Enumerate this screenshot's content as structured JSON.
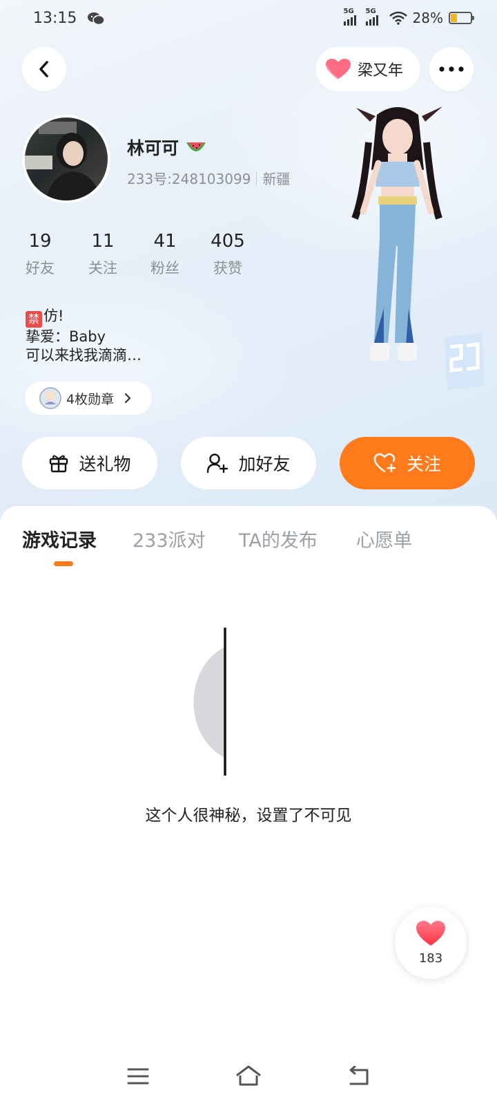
{
  "status_bar": {
    "time": "13:15",
    "network_1": "5G",
    "network_2": "5G",
    "battery": "28%"
  },
  "header": {
    "back_icon": "back-arrow-icon",
    "intimate_name": "梁又年",
    "more_icon": "more-dots-icon"
  },
  "profile": {
    "nickname": "林可可",
    "id_text": "233号:248103099",
    "location": "新疆"
  },
  "stats": [
    {
      "value": "19",
      "label": "好友"
    },
    {
      "value": "11",
      "label": "关注"
    },
    {
      "value": "41",
      "label": "粉丝"
    },
    {
      "value": "405",
      "label": "获赞"
    }
  ],
  "bio": {
    "ban_badge": "禁",
    "line1": "仿!",
    "line2": "挚爱：Baby",
    "line3": "可以来找我滴滴…"
  },
  "medals": {
    "label": "4枚勋章"
  },
  "actions": {
    "gift": "送礼物",
    "add_friend": "加好友",
    "follow": "关注"
  },
  "tabs": [
    {
      "label": "游戏记录",
      "active": true
    },
    {
      "label": "233派对",
      "active": false
    },
    {
      "label": "TA的发布",
      "active": false
    },
    {
      "label": "心愿单",
      "active": false
    }
  ],
  "empty_state": {
    "message": "这个人很神秘，设置了不可见"
  },
  "like_float": {
    "count": "183"
  },
  "colors": {
    "accent": "#ff7a1a",
    "follow_bg": "#ff7a1a",
    "heart": "#ff5a6b"
  }
}
